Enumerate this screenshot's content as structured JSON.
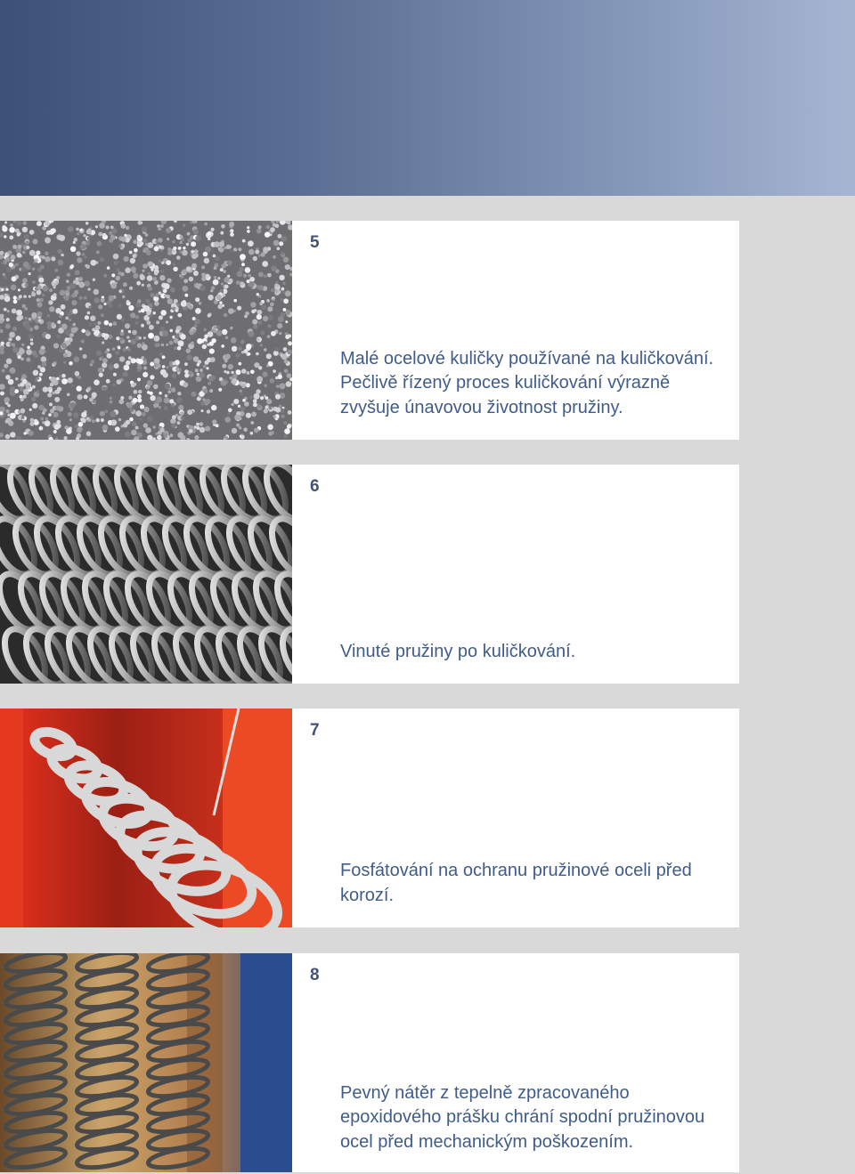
{
  "header": {
    "gradient": [
      "#3d5075",
      "#a6b5d2"
    ]
  },
  "panels": [
    {
      "number": "5",
      "caption": "Malé ocelové kuličky používané na kuličkování. Pečlivě řízený proces kuličkování výrazně zvyšuje únavovou životnost pružiny.",
      "photo": "steel-shot-balls"
    },
    {
      "number": "6",
      "caption": "Vinuté pružiny po kuličkování.",
      "photo": "shot-peened-springs"
    },
    {
      "number": "7",
      "caption": "Fosfátování na ochranu pružinové oceli před korozí.",
      "photo": "phosphating-springs"
    },
    {
      "number": "8",
      "caption": "Pevný nátěr z tepelně zpracovaného epoxidového prášku chrání spodní pružinovou ocel před mechanickým poškozením.",
      "photo": "epoxy-coating-springs"
    }
  ],
  "colors": {
    "number": "#3f5478",
    "caption": "#3f5c8a",
    "background": "#d9d9da"
  }
}
